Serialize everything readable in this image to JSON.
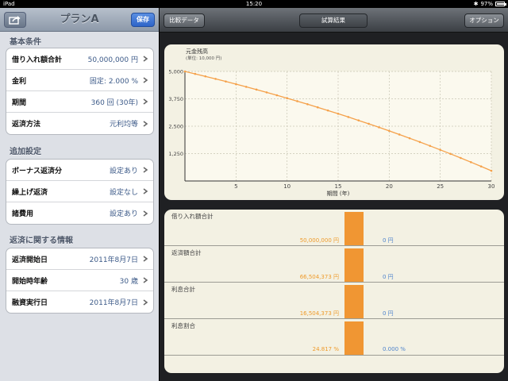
{
  "status": {
    "carrier": "iPad",
    "time": "15:20",
    "battery": "97%",
    "battery_level": 0.97
  },
  "left": {
    "title": "プランA",
    "save_label": "保存",
    "sections": [
      {
        "title": "基本条件",
        "rows": [
          {
            "label": "借り入れ額合計",
            "value": "50,000,000 円"
          },
          {
            "label": "金利",
            "value": "固定: 2.000 %"
          },
          {
            "label": "期間",
            "value": "360 回 (30年)"
          },
          {
            "label": "返済方法",
            "value": "元利均等"
          }
        ]
      },
      {
        "title": "追加設定",
        "rows": [
          {
            "label": "ボーナス返済分",
            "value": "設定あり"
          },
          {
            "label": "繰上げ返済",
            "value": "設定なし"
          },
          {
            "label": "諸費用",
            "value": "設定あり"
          }
        ]
      },
      {
        "title": "返済に関する情報",
        "rows": [
          {
            "label": "返済開始日",
            "value": "2011年8月7日"
          },
          {
            "label": "開始時年齢",
            "value": "30 歳"
          },
          {
            "label": "融資実行日",
            "value": "2011年8月7日"
          }
        ]
      }
    ]
  },
  "right": {
    "compare_label": "比較データ",
    "result_label": "試算結果",
    "options_label": "オプション"
  },
  "chart_data": {
    "type": "line",
    "title": "元金残高",
    "subtitle": "(単位: 10,000 円)",
    "xlabel": "期間 (年)",
    "ylabel": "",
    "xlim": [
      0,
      30
    ],
    "ylim": [
      0,
      5000
    ],
    "xticks": [
      5,
      10,
      15,
      20,
      25,
      30
    ],
    "yticks": [
      1250,
      2500,
      3750,
      5000
    ],
    "ytick_labels": [
      "1,250",
      "2,500",
      "3,750",
      "5,000"
    ],
    "grid": true,
    "color": "#f5a14a",
    "series": [
      {
        "x": [
          0,
          1,
          2,
          3,
          4,
          5,
          6,
          7,
          8,
          9,
          10,
          11,
          12,
          13,
          14,
          15,
          16,
          17,
          18,
          19,
          20,
          21,
          22,
          23,
          24,
          25,
          26,
          27,
          28,
          29,
          30
        ],
        "values": [
          5000,
          4889,
          4776,
          4660,
          4542,
          4421,
          4298,
          4172,
          4044,
          3913,
          3779,
          3643,
          3504,
          3362,
          3218,
          3070,
          2920,
          2766,
          2610,
          2450,
          2287,
          2121,
          1951,
          1778,
          1602,
          1422,
          1238,
          1051,
          860,
          665,
          466
        ]
      }
    ]
  },
  "summary": {
    "rows": [
      {
        "label": "借り入れ額合計",
        "a": "50,000,000 円",
        "b": "0 円"
      },
      {
        "label": "返済額合計",
        "a": "66,504,373 円",
        "b": "0 円"
      },
      {
        "label": "利息合計",
        "a": "16,504,373 円",
        "b": "0 円"
      },
      {
        "label": "利息割合",
        "a": "24.817 %",
        "b": "0.000 %"
      }
    ]
  }
}
